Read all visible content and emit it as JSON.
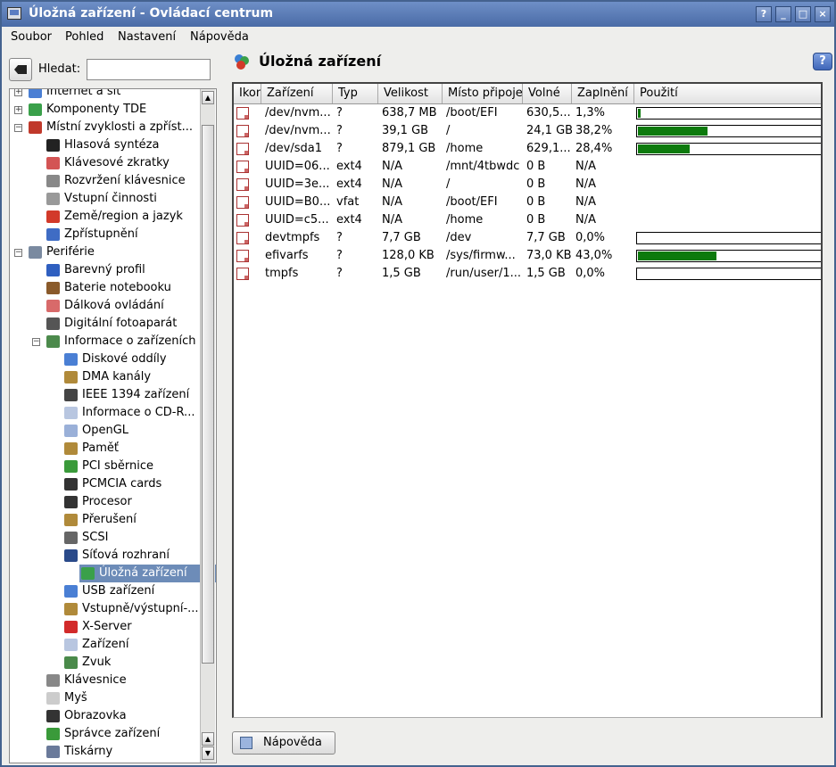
{
  "window": {
    "title": "Úložná zařízení - Ovládací centrum",
    "title_buttons": [
      "?",
      "_",
      "□",
      "×"
    ]
  },
  "menubar": {
    "items": [
      "Soubor",
      "Pohled",
      "Nastavení",
      "Nápověda"
    ]
  },
  "search": {
    "label": "Hledat:",
    "value": ""
  },
  "tree": {
    "items": [
      {
        "label": "Internet a síť",
        "level": 0,
        "expander": "+",
        "icon": "network-icon",
        "color": "#4a7fd4"
      },
      {
        "label": "Komponenty TDE",
        "level": 0,
        "expander": "+",
        "icon": "components-icon",
        "color": "#3aa04a"
      },
      {
        "label": "Místní zvyklosti a zpříst...",
        "level": 0,
        "expander": "−",
        "icon": "locale-books-icon",
        "color": "#c0392b"
      },
      {
        "label": "Hlasová syntéza",
        "level": 1,
        "icon": "speech-icon",
        "color": "#222222"
      },
      {
        "label": "Klávesové zkratky",
        "level": 1,
        "icon": "shortcuts-icon",
        "color": "#d35454"
      },
      {
        "label": "Rozvržení klávesnice",
        "level": 1,
        "icon": "keyboard-layout-icon",
        "color": "#888888"
      },
      {
        "label": "Vstupní činnosti",
        "level": 1,
        "icon": "input-actions-icon",
        "color": "#999999"
      },
      {
        "label": "Země/region a jazyk",
        "level": 1,
        "icon": "country-flag-icon",
        "color": "#d23a2a"
      },
      {
        "label": "Zpřístupnění",
        "level": 1,
        "icon": "accessibility-icon",
        "color": "#3f6cc4"
      },
      {
        "label": "Periférie",
        "level": 0,
        "expander": "−",
        "icon": "peripherals-icon",
        "color": "#7a8aa0"
      },
      {
        "label": "Barevný profil",
        "level": 1,
        "icon": "color-profile-icon",
        "color": "#2f5fc0"
      },
      {
        "label": "Baterie notebooku",
        "level": 1,
        "icon": "battery-icon",
        "color": "#8a5a2a"
      },
      {
        "label": "Dálková ovládání",
        "level": 1,
        "icon": "remote-icon",
        "color": "#d86a6a"
      },
      {
        "label": "Digitální fotoaparát",
        "level": 1,
        "icon": "camera-icon",
        "color": "#555555"
      },
      {
        "label": "Informace o zařízeních",
        "level": 1,
        "expander": "−",
        "icon": "device-info-icon",
        "color": "#4c8a4c"
      },
      {
        "label": "Diskové oddíly",
        "level": 2,
        "icon": "partitions-icon",
        "color": "#4a7fd4"
      },
      {
        "label": "DMA kanály",
        "level": 2,
        "icon": "dma-icon",
        "color": "#b08a3a"
      },
      {
        "label": "IEEE 1394 zařízení",
        "level": 2,
        "icon": "firewire-icon",
        "color": "#444444"
      },
      {
        "label": "Informace o CD-R...",
        "level": 2,
        "icon": "cdrom-icon",
        "color": "#b8c6e0"
      },
      {
        "label": "OpenGL",
        "level": 2,
        "icon": "opengl-icon",
        "color": "#9ab0d8"
      },
      {
        "label": "Paměť",
        "level": 2,
        "icon": "memory-icon",
        "color": "#b08a3a"
      },
      {
        "label": "PCI sběrnice",
        "level": 2,
        "icon": "pci-icon",
        "color": "#3a9a3a"
      },
      {
        "label": "PCMCIA cards",
        "level": 2,
        "icon": "pcmcia-icon",
        "color": "#333333"
      },
      {
        "label": "Procesor",
        "level": 2,
        "icon": "cpu-icon",
        "color": "#333333"
      },
      {
        "label": "Přerušení",
        "level": 2,
        "icon": "interrupts-icon",
        "color": "#b08a3a"
      },
      {
        "label": "SCSI",
        "level": 2,
        "icon": "scsi-icon",
        "color": "#666666"
      },
      {
        "label": "Síťová rozhraní",
        "level": 2,
        "icon": "network-interfaces-icon",
        "color": "#2a4a8a"
      },
      {
        "label": "Úložná zařízení",
        "level": 2,
        "icon": "storage-icon",
        "color": "#3aa04a",
        "selected": true
      },
      {
        "label": "USB zařízení",
        "level": 2,
        "icon": "usb-icon",
        "color": "#4a7fd4"
      },
      {
        "label": "Vstupně/výstupní-...",
        "level": 2,
        "icon": "io-ports-icon",
        "color": "#b08a3a"
      },
      {
        "label": "X-Server",
        "level": 2,
        "icon": "xserver-icon",
        "color": "#d22a2a"
      },
      {
        "label": "Zařízení",
        "level": 2,
        "icon": "devices-icon",
        "color": "#b8c6e0"
      },
      {
        "label": "Zvuk",
        "level": 2,
        "icon": "sound-icon",
        "color": "#4a8a4a"
      },
      {
        "label": "Klávesnice",
        "level": 1,
        "icon": "keyboard-icon",
        "color": "#888888"
      },
      {
        "label": "Myš",
        "level": 1,
        "icon": "mouse-icon",
        "color": "#cccccc"
      },
      {
        "label": "Obrazovka",
        "level": 1,
        "icon": "display-icon",
        "color": "#333333"
      },
      {
        "label": "Správce zařízení",
        "level": 1,
        "icon": "device-manager-icon",
        "color": "#3a9a3a"
      },
      {
        "label": "Tiskárny",
        "level": 1,
        "icon": "printer-icon",
        "color": "#6a7a9a"
      }
    ]
  },
  "header": {
    "title": "Úložná zařízení",
    "icon": "storage-icon"
  },
  "table": {
    "columns": [
      "Ikona",
      "Zařízení",
      "Typ",
      "Velikost",
      "Místo připojení",
      "Volné",
      "Zaplnění",
      "Použití"
    ],
    "rows": [
      {
        "device": "/dev/nvm...",
        "type": "?",
        "size": "638,7 MB",
        "mount": "/boot/EFI",
        "free": "630,5...",
        "used_pct": "1,3%",
        "usage": 0.013
      },
      {
        "device": "/dev/nvm...",
        "type": "?",
        "size": "39,1 GB",
        "mount": "/",
        "free": "24,1 GB",
        "used_pct": "38,2%",
        "usage": 0.382
      },
      {
        "device": "/dev/sda1",
        "type": "?",
        "size": "879,1 GB",
        "mount": "/home",
        "free": "629,1...",
        "used_pct": "28,4%",
        "usage": 0.284
      },
      {
        "device": "UUID=06...",
        "type": "ext4",
        "size": "N/A",
        "mount": "/mnt/4tbwdc",
        "free": "0 B",
        "used_pct": "N/A",
        "usage": null
      },
      {
        "device": "UUID=3e...",
        "type": "ext4",
        "size": "N/A",
        "mount": "/",
        "free": "0 B",
        "used_pct": "N/A",
        "usage": null
      },
      {
        "device": "UUID=B0...",
        "type": "vfat",
        "size": "N/A",
        "mount": "/boot/EFI",
        "free": "0 B",
        "used_pct": "N/A",
        "usage": null
      },
      {
        "device": "UUID=c5...",
        "type": "ext4",
        "size": "N/A",
        "mount": "/home",
        "free": "0 B",
        "used_pct": "N/A",
        "usage": null
      },
      {
        "device": "devtmpfs",
        "type": "?",
        "size": "7,7 GB",
        "mount": "/dev",
        "free": "7,7 GB",
        "used_pct": "0,0%",
        "usage": 0.0
      },
      {
        "device": "efivarfs",
        "type": "?",
        "size": "128,0 KB",
        "mount": "/sys/firmw...",
        "free": "73,0 KB",
        "used_pct": "43,0%",
        "usage": 0.43
      },
      {
        "device": "tmpfs",
        "type": "?",
        "size": "1,5 GB",
        "mount": "/run/user/1...",
        "free": "1,5 GB",
        "used_pct": "0,0%",
        "usage": 0.0
      }
    ]
  },
  "footer": {
    "help_button": "Nápověda"
  },
  "colors": {
    "titlebar": "#4a6ba6",
    "selection": "#6d8cb8",
    "usage_fill": "#0d7a0d"
  }
}
